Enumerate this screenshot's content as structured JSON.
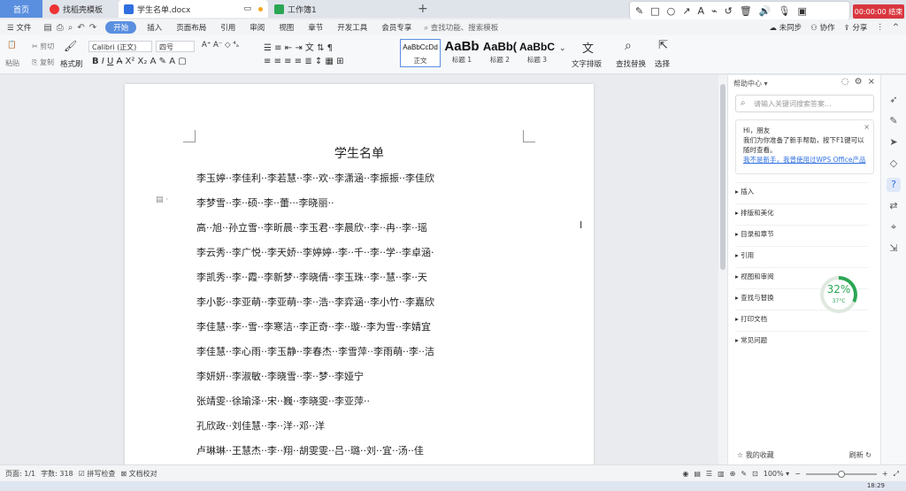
{
  "tabs": {
    "home": "首页",
    "t1": "找稻壳模板",
    "t2": "学生名单.docx",
    "t3": "工作簿1"
  },
  "recording": "00:00:00 结束",
  "menu": {
    "file": "文件",
    "items": [
      "开始",
      "插入",
      "页面布局",
      "引用",
      "审阅",
      "视图",
      "章节",
      "开发工具",
      "会员专享"
    ],
    "search": "查找功能、搜索模板",
    "right": [
      "未同步",
      "协作",
      "分享"
    ]
  },
  "ribbon": {
    "cut": "剪切",
    "copy": "复制",
    "paste": "粘贴",
    "format_painter": "格式刷",
    "font": "Calibri (正文)",
    "size": "四号",
    "styles": [
      {
        "sample": "AaBbCcDd",
        "caption": "正文"
      },
      {
        "sample": "AaBb",
        "caption": "标题 1"
      },
      {
        "sample": "AaBb(",
        "caption": "标题 2"
      },
      {
        "sample": "AaBbC",
        "caption": "标题 3"
      }
    ],
    "text_layout": "文字排版",
    "find_replace": "查找替换",
    "select": "选择"
  },
  "document": {
    "title": "学生名单",
    "lines": [
      "李玉婷··李佳利··李若慧··李··欢··李潇涵··李振振··李佳欣",
      "李梦雪··李··硕··李··蕾···李晓丽··",
      "高··旭··孙立雪··李昕晨··李玉君··李晨欣··李··冉··李··瑶",
      "李云秀··李广悦··李天娇··李婷婷··李··千··李··学··李卓涵·",
      "李凯秀··李··霞··李新梦··李晓倩··李玉珠··李··慧··李··天",
      "李小影··李亚萌··李亚萌··李··浩··李弈涵··李小竹··李嘉欣",
      "李佳慧··李··雪··李寒洁··李正奇··李··璇··李为雪··李婧宜",
      "李佳慧··李心雨··李玉静··李春杰··李雪萍··李雨萌··李··洁",
      "李妍妍··李淑敏··李晓雪··李··梦··李娅宁",
      "张靖雯··徐瑜泽··宋··巍··李晓雯··李亚萍··",
      "孔欣政··刘佳慧··李··洋··邓··洋",
      "卢琳琳··王慧杰··李··翔··胡雯雯··吕··璐··刘··宜··汤··佳"
    ]
  },
  "help": {
    "title": "帮助中心",
    "search_placeholder": "请输入关键词搜索答案...",
    "greeting": "Hi，朋友",
    "intro": "我们为你准备了新手帮助，按下F1键可以随时查看。",
    "link": "我不是新手，我曾使用过WPS Office产品",
    "sections": [
      "插入",
      "排版和美化",
      "目录和章节",
      "引用",
      "视图和审阅",
      "查找与替换",
      "打印文档",
      "常见问题"
    ],
    "favorites": "我的收藏",
    "refresh": "刷新"
  },
  "perf": {
    "percent": "32%",
    "temp": "37°C"
  },
  "status": {
    "page": "页面: 1/1",
    "words": "字数: 318",
    "spell": "拼写检查",
    "proof": "文档校对",
    "zoom": "100%"
  },
  "clock": "18:29"
}
